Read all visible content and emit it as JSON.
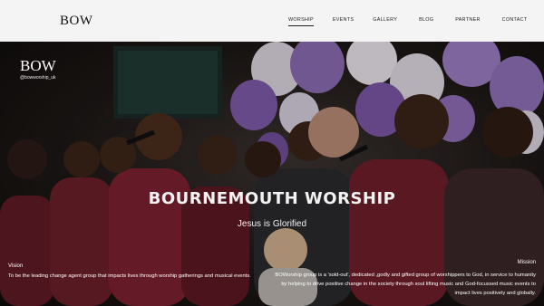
{
  "header": {
    "logo": "BOW",
    "nav": [
      {
        "label": "WORSHIP",
        "active": true
      },
      {
        "label": "EVENTS",
        "active": false
      },
      {
        "label": "GALLERY",
        "active": false
      },
      {
        "label": "BLOG",
        "active": false
      },
      {
        "label": "PARTNER",
        "active": false
      },
      {
        "label": "CONTACT",
        "active": false
      }
    ]
  },
  "hero": {
    "logo": "BOW",
    "handle": "@bowworship_uk",
    "title": "BOURNEMOUTH WORSHIP",
    "subtitle": "Jesus is Glorified",
    "vision": {
      "heading": "Vision",
      "text": "To be the leading change agent group that impacts lives through worship gatherings and musical events."
    },
    "mission": {
      "heading": "Mission",
      "text": "BOWorship group is a 'sold-out', dedicated ,godly and gifted group of worshippers to God, in service to humanity by helping to drive positive change in the society through soul lifting music and God-focussed music events to impact lives positively and globally."
    },
    "colors": {
      "balloon_purple": "#7d5ba6",
      "balloon_white": "#e8e4ec",
      "shirt_maroon": "#6e1f2a"
    }
  }
}
